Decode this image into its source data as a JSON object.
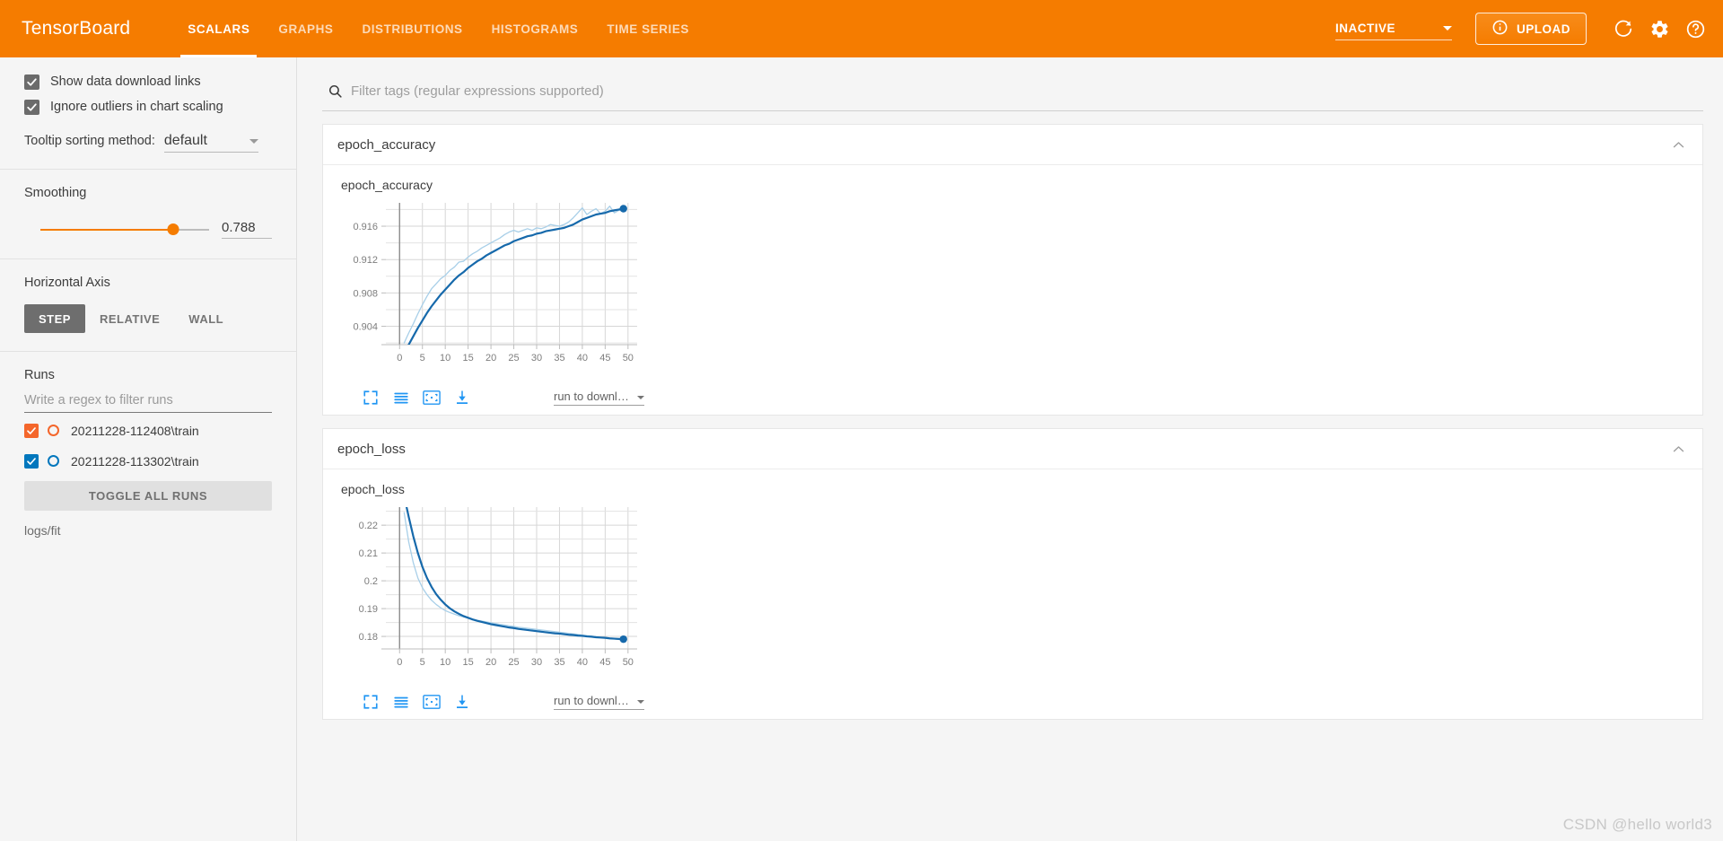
{
  "header": {
    "brand": "TensorBoard",
    "tabs": [
      {
        "label": "SCALARS",
        "active": true
      },
      {
        "label": "GRAPHS",
        "active": false
      },
      {
        "label": "DISTRIBUTIONS",
        "active": false
      },
      {
        "label": "HISTOGRAMS",
        "active": false
      },
      {
        "label": "TIME SERIES",
        "active": false
      }
    ],
    "run_state": "INACTIVE",
    "upload_label": "UPLOAD",
    "icons": [
      "info-icon",
      "refresh-icon",
      "gear-icon",
      "help-icon"
    ],
    "accent_color": "#f57c00"
  },
  "sidebar": {
    "checkboxes": [
      {
        "label": "Show data download links",
        "checked": true
      },
      {
        "label": "Ignore outliers in chart scaling",
        "checked": true
      }
    ],
    "tooltip": {
      "label": "Tooltip sorting method:",
      "value": "default"
    },
    "smoothing": {
      "title": "Smoothing",
      "value": "0.788",
      "fraction": 0.788
    },
    "horizontal_axis": {
      "title": "Horizontal Axis",
      "options": [
        {
          "label": "STEP",
          "active": true
        },
        {
          "label": "RELATIVE",
          "active": false
        },
        {
          "label": "WALL",
          "active": false
        }
      ]
    },
    "runs": {
      "title": "Runs",
      "filter_placeholder": "Write a regex to filter runs",
      "items": [
        {
          "label": "20211228-112408\\train",
          "checked": true,
          "color": "#f4662b"
        },
        {
          "label": "20211228-113302\\train",
          "checked": true,
          "color": "#0277bd"
        }
      ],
      "toggle_all_label": "TOGGLE ALL RUNS",
      "logdir": "logs/fit"
    }
  },
  "main": {
    "tag_filter_placeholder": "Filter tags (regular expressions supported)",
    "cards": [
      {
        "title": "epoch_accuracy",
        "chart_label": "epoch_accuracy",
        "run_download_label": "run to downl…",
        "toolbar_icons": [
          "fullscreen-icon",
          "log-scale-icon",
          "fit-domain-icon",
          "download-icon"
        ]
      },
      {
        "title": "epoch_loss",
        "chart_label": "epoch_loss",
        "run_download_label": "run to downl…",
        "toolbar_icons": [
          "fullscreen-icon",
          "log-scale-icon",
          "fit-domain-icon",
          "download-icon"
        ]
      }
    ]
  },
  "watermark": "CSDN @hello world3",
  "chart_data": [
    {
      "type": "line",
      "title": "epoch_accuracy",
      "xlabel": "",
      "ylabel": "",
      "xlim": [
        -3,
        52
      ],
      "ylim": [
        0.9018,
        0.9188
      ],
      "xticks": [
        0,
        5,
        10,
        15,
        20,
        25,
        30,
        35,
        40,
        45,
        50
      ],
      "ytick_labels": [
        "0.904",
        "0.908",
        "0.912",
        "0.916"
      ],
      "yticks": [
        0.904,
        0.908,
        0.912,
        0.916
      ],
      "grid": true,
      "legend": "none",
      "series": [
        {
          "name": "raw",
          "color": "#a8cfe8",
          "x": [
            1,
            2,
            3,
            4,
            5,
            6,
            7,
            8,
            9,
            10,
            11,
            12,
            13,
            14,
            15,
            16,
            17,
            18,
            19,
            20,
            21,
            22,
            23,
            24,
            25,
            26,
            27,
            28,
            29,
            30,
            31,
            32,
            33,
            34,
            35,
            36,
            37,
            38,
            39,
            40,
            41,
            42,
            43,
            44,
            45,
            46,
            47,
            48,
            49
          ],
          "y": [
            0.902,
            0.9032,
            0.9043,
            0.9055,
            0.9066,
            0.9076,
            0.9085,
            0.9091,
            0.9097,
            0.9101,
            0.9107,
            0.9111,
            0.9117,
            0.9118,
            0.9123,
            0.9127,
            0.913,
            0.9134,
            0.9137,
            0.914,
            0.9143,
            0.9146,
            0.915,
            0.9153,
            0.9155,
            0.9153,
            0.9155,
            0.9157,
            0.9155,
            0.9158,
            0.9157,
            0.9159,
            0.9162,
            0.9161,
            0.916,
            0.9162,
            0.9165,
            0.917,
            0.9176,
            0.9182,
            0.9174,
            0.9178,
            0.9181,
            0.9175,
            0.9178,
            0.9184,
            0.9176,
            0.9179,
            0.918
          ]
        },
        {
          "name": "smoothed",
          "color": "#1669ab",
          "x": [
            1,
            2,
            3,
            4,
            5,
            6,
            7,
            8,
            9,
            10,
            11,
            12,
            13,
            14,
            15,
            16,
            17,
            18,
            19,
            20,
            21,
            22,
            23,
            24,
            25,
            26,
            27,
            28,
            29,
            30,
            31,
            32,
            33,
            34,
            35,
            36,
            37,
            38,
            39,
            40,
            41,
            42,
            43,
            44,
            45,
            46,
            47,
            48,
            49
          ],
          "y": [
            0.9009,
            0.9018,
            0.9028,
            0.9038,
            0.9047,
            0.9056,
            0.9064,
            0.9071,
            0.9078,
            0.9084,
            0.909,
            0.9096,
            0.9101,
            0.9105,
            0.911,
            0.9114,
            0.9118,
            0.9121,
            0.9125,
            0.9128,
            0.9131,
            0.9134,
            0.9137,
            0.9139,
            0.9142,
            0.9144,
            0.9146,
            0.9148,
            0.9149,
            0.9151,
            0.9152,
            0.9154,
            0.9155,
            0.9156,
            0.9157,
            0.9158,
            0.916,
            0.9162,
            0.9165,
            0.9168,
            0.917,
            0.9172,
            0.9174,
            0.9175,
            0.9176,
            0.9178,
            0.9179,
            0.918,
            0.9181
          ]
        }
      ],
      "endpoint": {
        "x": 49,
        "y": 0.9181,
        "color": "#1669ab"
      }
    },
    {
      "type": "line",
      "title": "epoch_loss",
      "xlabel": "",
      "ylabel": "",
      "xlim": [
        -3,
        52
      ],
      "ylim": [
        0.1755,
        0.2265
      ],
      "xticks": [
        0,
        5,
        10,
        15,
        20,
        25,
        30,
        35,
        40,
        45,
        50
      ],
      "ytick_labels": [
        "0.18",
        "0.19",
        "0.2",
        "0.21",
        "0.22"
      ],
      "yticks": [
        0.18,
        0.19,
        0.2,
        0.21,
        0.22
      ],
      "grid": true,
      "legend": "none",
      "series": [
        {
          "name": "raw",
          "color": "#a8cfe8",
          "x": [
            1,
            2,
            3,
            4,
            5,
            6,
            7,
            8,
            9,
            10,
            11,
            12,
            13,
            14,
            15,
            16,
            17,
            18,
            19,
            20,
            21,
            22,
            23,
            24,
            25,
            26,
            27,
            28,
            29,
            30,
            31,
            32,
            33,
            34,
            35,
            36,
            37,
            38,
            39,
            40,
            41,
            42,
            43,
            44,
            45,
            46,
            47,
            48,
            49
          ],
          "y": [
            0.2245,
            0.214,
            0.2065,
            0.201,
            0.1975,
            0.195,
            0.193,
            0.1915,
            0.1903,
            0.1893,
            0.1886,
            0.188,
            0.1874,
            0.187,
            0.1866,
            0.1862,
            0.1858,
            0.1855,
            0.1852,
            0.1849,
            0.1846,
            0.1843,
            0.1841,
            0.1838,
            0.1836,
            0.1833,
            0.1831,
            0.1829,
            0.1827,
            0.1825,
            0.1823,
            0.1821,
            0.1819,
            0.1817,
            0.1815,
            0.1813,
            0.1811,
            0.1809,
            0.1807,
            0.1805,
            0.1803,
            0.1801,
            0.1799,
            0.1797,
            0.1795,
            0.1793,
            0.1791,
            0.1789,
            0.1787
          ]
        },
        {
          "name": "smoothed",
          "color": "#1669ab",
          "x": [
            1,
            2,
            3,
            4,
            5,
            6,
            7,
            8,
            9,
            10,
            11,
            12,
            13,
            14,
            15,
            16,
            17,
            18,
            19,
            20,
            21,
            22,
            23,
            24,
            25,
            26,
            27,
            28,
            29,
            30,
            31,
            32,
            33,
            34,
            35,
            36,
            37,
            38,
            39,
            40,
            41,
            42,
            43,
            44,
            45,
            46,
            47,
            48,
            49
          ],
          "y": [
            0.2305,
            0.223,
            0.216,
            0.21,
            0.205,
            0.201,
            0.1978,
            0.1952,
            0.1932,
            0.1915,
            0.1901,
            0.189,
            0.1881,
            0.1873,
            0.1867,
            0.1861,
            0.1856,
            0.1852,
            0.1848,
            0.1844,
            0.1841,
            0.1838,
            0.1835,
            0.1832,
            0.183,
            0.1827,
            0.1825,
            0.1823,
            0.1821,
            0.1819,
            0.1817,
            0.1815,
            0.1813,
            0.1811,
            0.181,
            0.1808,
            0.1806,
            0.1805,
            0.1803,
            0.1802,
            0.18,
            0.1799,
            0.1797,
            0.1796,
            0.1795,
            0.1793,
            0.1792,
            0.1791,
            0.179
          ]
        }
      ],
      "endpoint": {
        "x": 49,
        "y": 0.179,
        "color": "#1669ab"
      }
    }
  ]
}
